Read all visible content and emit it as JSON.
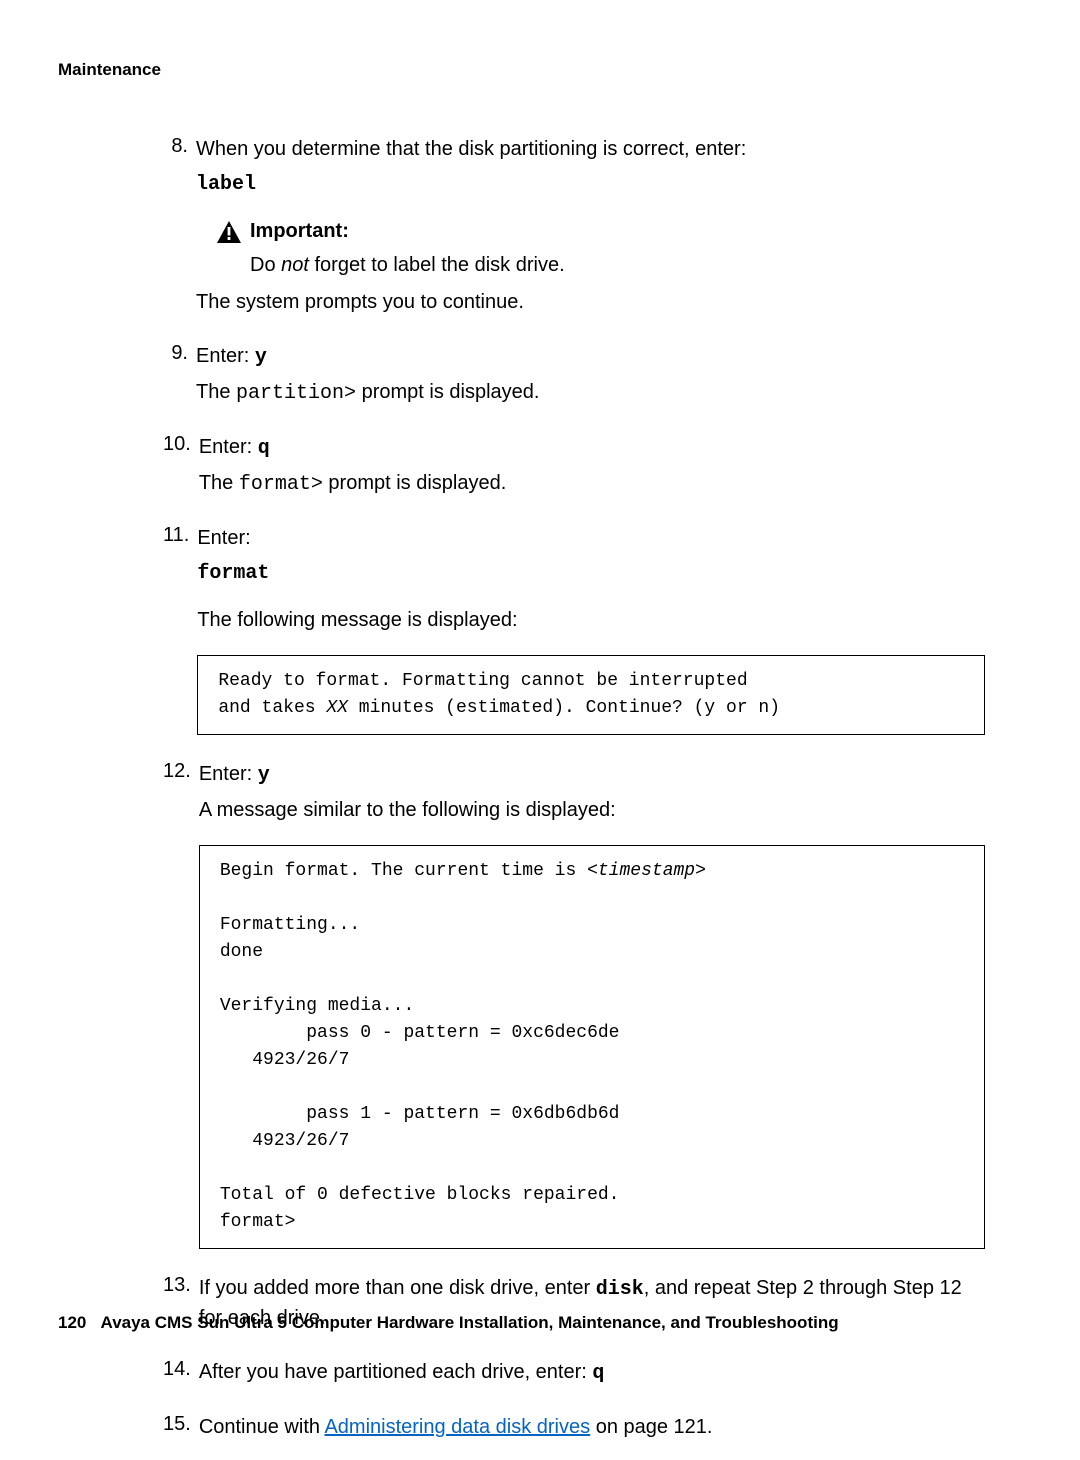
{
  "header": "Maintenance",
  "footer": {
    "pagenum": "120",
    "title": "Avaya CMS Sun Ultra 5 Computer Hardware Installation, Maintenance, and Troubleshooting"
  },
  "step8": {
    "num": "8.",
    "line": "When you determine that the disk partitioning is correct, enter:",
    "cmd": "label",
    "note_label": "Important:",
    "note_pre": "Do ",
    "note_em": "not",
    "note_post": " forget to label the disk drive.",
    "after": "The system prompts you to continue."
  },
  "step9": {
    "num": "9.",
    "prefix": "Enter: ",
    "cmd": "y",
    "line2a": "The ",
    "prompt": "partition>",
    "line2b": " prompt is displayed."
  },
  "step10": {
    "num": "10.",
    "prefix": "Enter: ",
    "cmd": "q",
    "line2a": "The ",
    "prompt": "format>",
    "line2b": " prompt is displayed."
  },
  "step11": {
    "num": "11.",
    "line": "Enter:",
    "cmd": "format",
    "after": "The following message is displayed:",
    "box_l1": "Ready to format. Formatting cannot be interrupted",
    "box_l2a": "and takes ",
    "box_xx": "XX",
    "box_l2b": " minutes (estimated). Continue? (y or n)"
  },
  "step12": {
    "num": "12.",
    "prefix": "Enter: ",
    "cmd": "y",
    "after": "A message similar to the following is displayed:",
    "box_l1a": "Begin format. The current time is ",
    "box_ts": "<timestamp>",
    "box_l2": "Formatting...",
    "box_l3": "done",
    "box_l4": "Verifying media...",
    "box_l5": "        pass 0 - pattern = 0xc6dec6de",
    "box_l6": "   4923/26/7",
    "box_l7": "        pass 1 - pattern = 0x6db6db6d",
    "box_l8": "   4923/26/7",
    "box_l9": "Total of 0 defective blocks repaired.",
    "box_l10": "format>"
  },
  "step13": {
    "num": "13.",
    "a": "If you added more than one disk drive, enter ",
    "cmd": "disk",
    "b": ", and repeat Step 2 through Step 12 for each drive."
  },
  "step14": {
    "num": "14.",
    "a": "After you have partitioned each drive, enter: ",
    "cmd": "q"
  },
  "step15": {
    "num": "15.",
    "a": "Continue with ",
    "link": "Administering data disk drives",
    "b": " on page 121."
  }
}
